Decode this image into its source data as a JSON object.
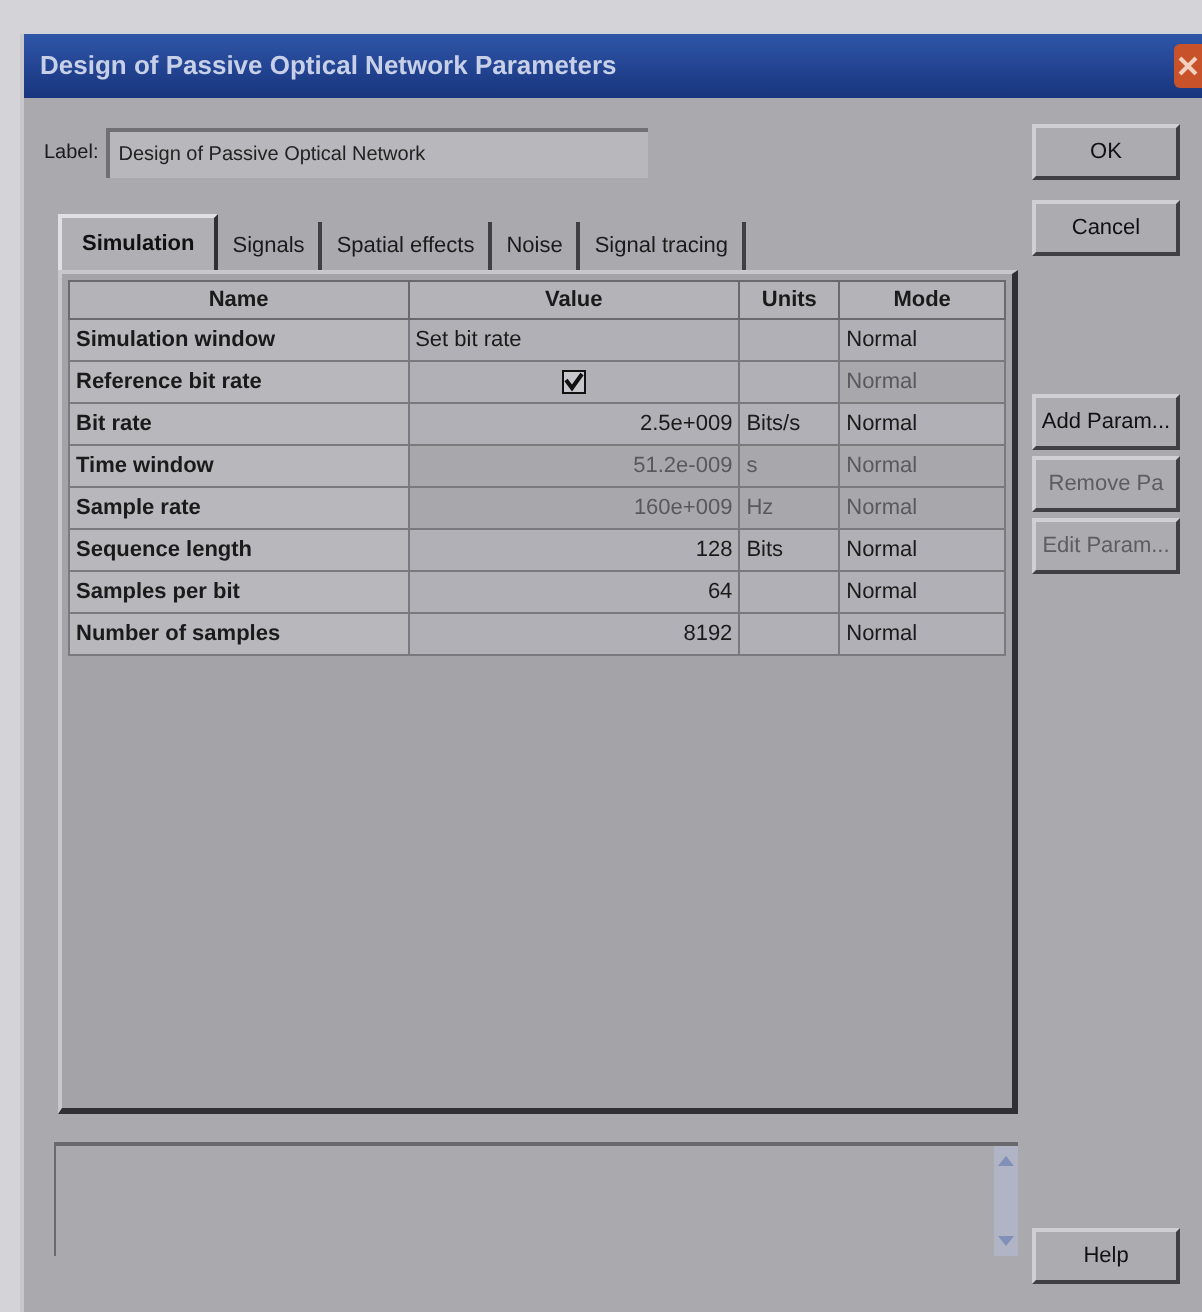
{
  "window": {
    "title": "Design of Passive Optical Network Parameters"
  },
  "label": {
    "caption": "Label:",
    "value": "Design of Passive Optical Network"
  },
  "tabs": [
    {
      "label": "Simulation",
      "selected": true
    },
    {
      "label": "Signals",
      "selected": false
    },
    {
      "label": "Spatial effects",
      "selected": false
    },
    {
      "label": "Noise",
      "selected": false
    },
    {
      "label": "Signal tracing",
      "selected": false
    }
  ],
  "table": {
    "columns": [
      "Name",
      "Value",
      "Units",
      "Mode"
    ],
    "rows": [
      {
        "name": "Simulation window",
        "kind": "text",
        "value": "Set bit rate",
        "units": "",
        "mode": "Normal",
        "value_disabled": false,
        "mode_disabled": false
      },
      {
        "name": "Reference bit rate",
        "kind": "checkbox",
        "checked": true,
        "units": "",
        "mode": "Normal",
        "value_disabled": false,
        "mode_disabled": true
      },
      {
        "name": "Bit rate",
        "kind": "number",
        "value": "2.5e+009",
        "units": "Bits/s",
        "mode": "Normal",
        "value_disabled": false,
        "mode_disabled": false
      },
      {
        "name": "Time window",
        "kind": "number",
        "value": "51.2e-009",
        "units": "s",
        "mode": "Normal",
        "value_disabled": true,
        "mode_disabled": true
      },
      {
        "name": "Sample rate",
        "kind": "number",
        "value": "160e+009",
        "units": "Hz",
        "mode": "Normal",
        "value_disabled": true,
        "mode_disabled": true
      },
      {
        "name": "Sequence length",
        "kind": "number",
        "value": "128",
        "units": "Bits",
        "mode": "Normal",
        "value_disabled": false,
        "mode_disabled": false
      },
      {
        "name": "Samples per bit",
        "kind": "number",
        "value": "64",
        "units": "",
        "mode": "Normal",
        "value_disabled": false,
        "mode_disabled": false
      },
      {
        "name": "Number of samples",
        "kind": "number",
        "value": "8192",
        "units": "",
        "mode": "Normal",
        "value_disabled": false,
        "mode_disabled": false
      }
    ]
  },
  "dialog_buttons": [
    {
      "label": "OK",
      "disabled": false
    },
    {
      "label": "Cancel",
      "disabled": false
    }
  ],
  "parameter_buttons": [
    {
      "label": "Add Param...",
      "disabled": false
    },
    {
      "label": "Remove Pa",
      "disabled": true
    },
    {
      "label": "Edit Param...",
      "disabled": true
    }
  ],
  "help_button": {
    "label": "Help",
    "disabled": false
  }
}
